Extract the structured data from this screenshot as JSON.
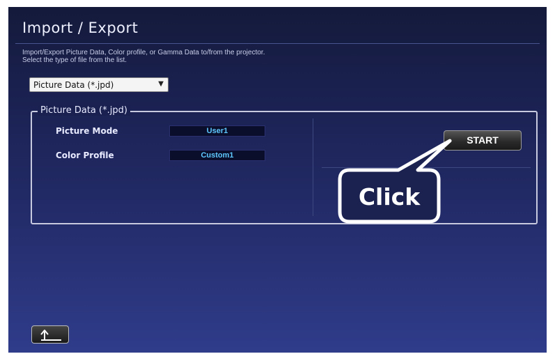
{
  "window": {
    "title": "Import / Export"
  },
  "description": {
    "line1": "Import/Export Picture Data, Color profile, or Gamma Data to/from the projector.",
    "line2": "Select the type of file from the list."
  },
  "file_type_select": {
    "selected": "Picture Data (*.jpd)"
  },
  "group": {
    "legend": "Picture Data (*.jpd)",
    "rows": [
      {
        "label": "Picture Mode",
        "value": "User1"
      },
      {
        "label": "Color Profile",
        "value": "Custom1"
      }
    ]
  },
  "start_button": {
    "label": "START"
  },
  "callout": {
    "text": "Click"
  },
  "back_button": {
    "icon": "return-arrow-icon"
  }
}
